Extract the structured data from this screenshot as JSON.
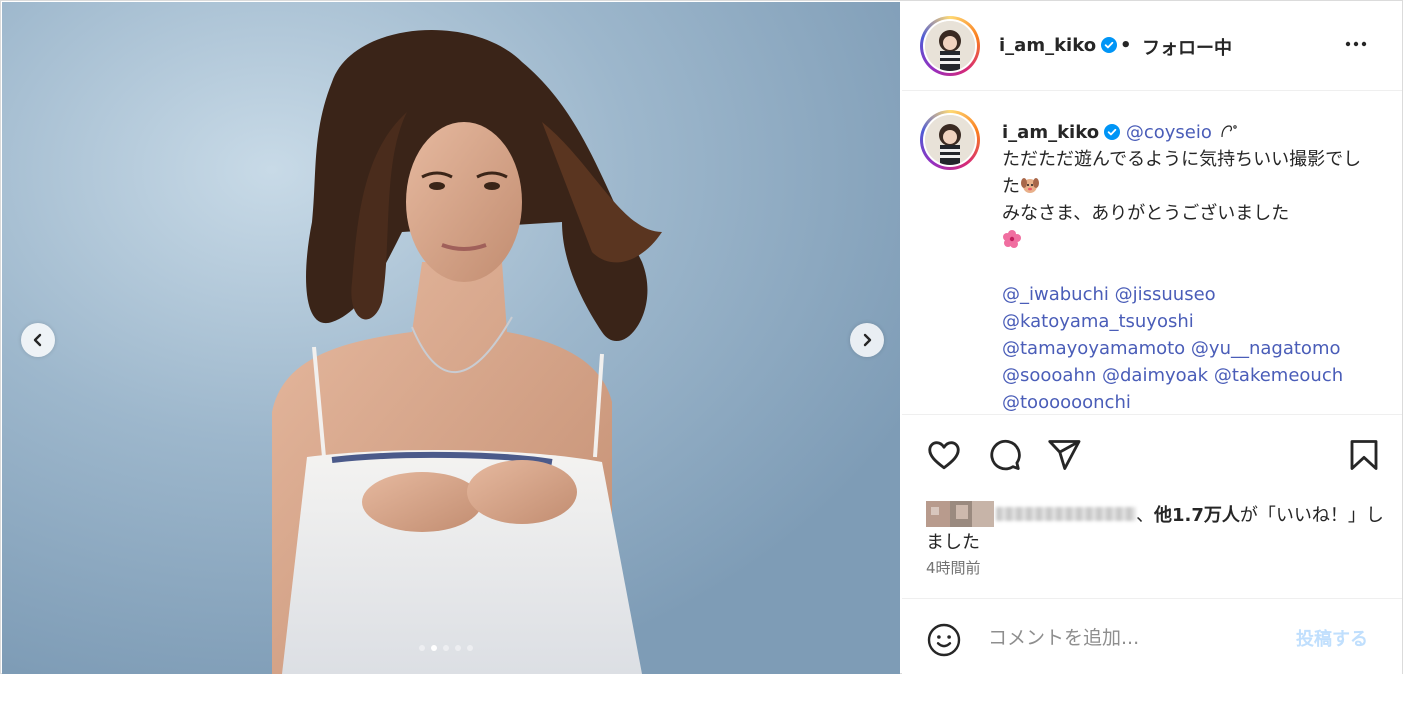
{
  "post": {
    "media": {
      "carousel_dot_count": 5,
      "active_dot": 1,
      "prev_icon": "chevron-left-icon",
      "next_icon": "chevron-right-icon"
    },
    "header": {
      "username": "i_am_kiko",
      "verified_icon": "verified-badge-icon",
      "separator": "•",
      "follow_status": "フォロー中",
      "more_icon": "more-options-icon"
    },
    "caption": {
      "username": "i_am_kiko",
      "first_mention": "@coyseio",
      "line_text_1": "ただただ遊んでるように気持ちいい撮影でした",
      "line_text_2": "みなさま、ありがとうございました",
      "mentions": [
        "@_iwabuchi",
        "@jissuuseo",
        "@katoyama_tsuyoshi",
        "@tamayoyamamoto",
        "@yu__nagatomo",
        "@soooahn",
        "@daimyoak",
        "@takemeouch",
        "@toooooonchi"
      ]
    },
    "actions": {
      "like_icon": "heart-icon",
      "comment_icon": "comment-icon",
      "share_icon": "share-icon",
      "save_icon": "bookmark-icon"
    },
    "likes": {
      "separator": "、",
      "count_text": "他1.7万人",
      "suffix": "が「いいね！」しました"
    },
    "timestamp": "4時間前",
    "comment": {
      "placeholder": "コメントを追加...",
      "post_label": "投稿する",
      "emoji_icon": "emoji-smile-icon"
    },
    "colors": {
      "mention": "#4a5db8",
      "post_button_disabled": "#c0dffd",
      "verified": "#0095f6"
    }
  }
}
